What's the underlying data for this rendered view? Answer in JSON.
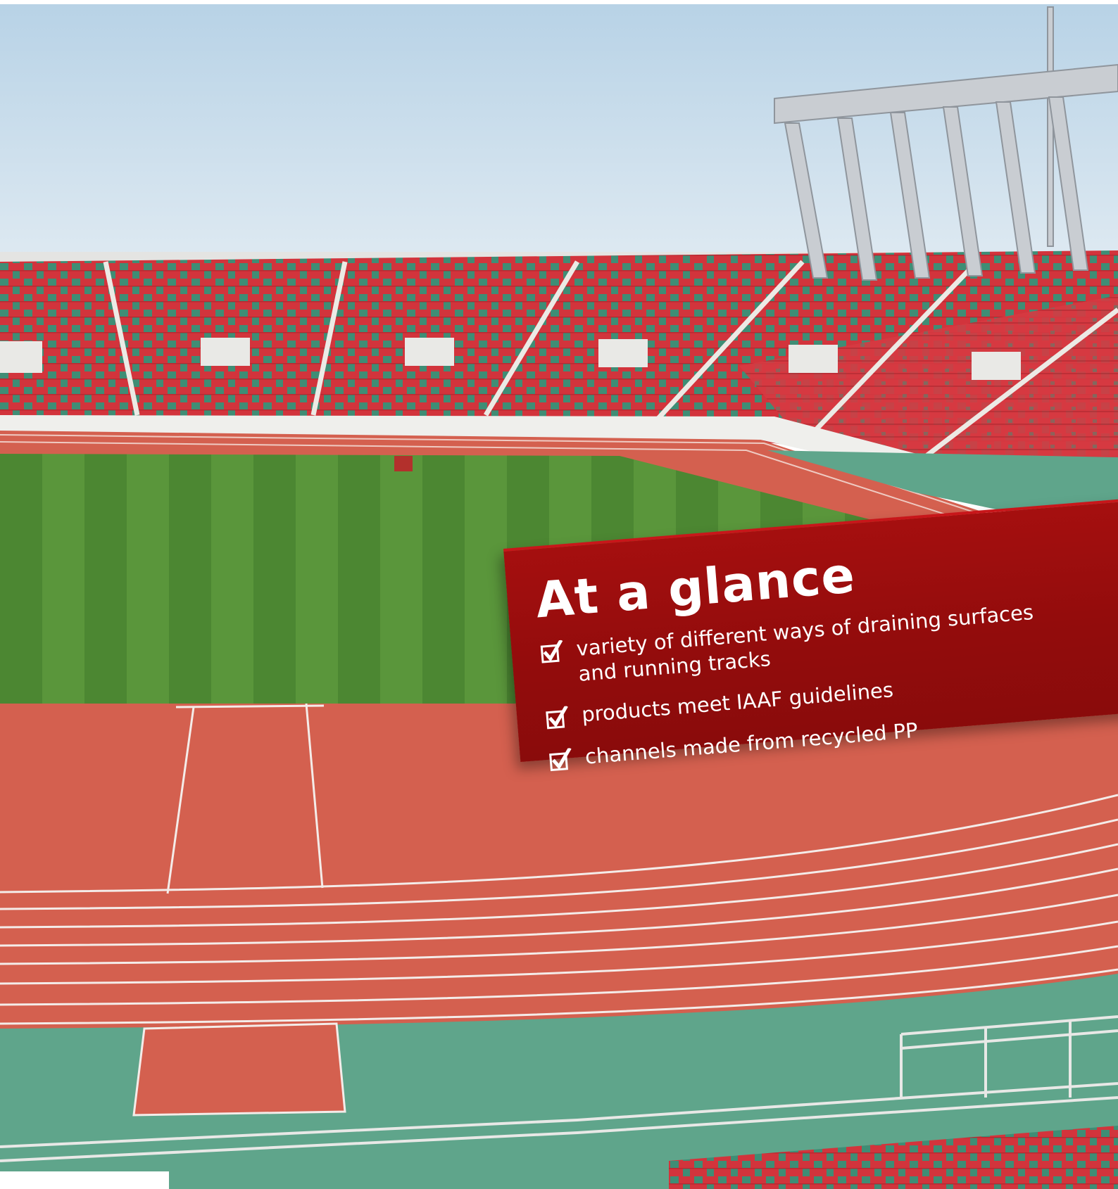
{
  "colors": {
    "sky_top": "#b9d3e6",
    "sky_bottom": "#dbe8f1",
    "seat_red": "#d2343c",
    "seat_green": "#3f8d75",
    "grass_light": "#5f9a3e",
    "grass_dark": "#4d8a32",
    "track": "#d4604f",
    "apron": "#5fa58b",
    "card_red": "#9c0e0e",
    "text": "#ffffff"
  },
  "glance": {
    "title": "At a glance",
    "items": [
      {
        "icon": "checkbox-checked-icon",
        "text": "variety of different ways of draining surfaces\nand running tracks"
      },
      {
        "icon": "checkbox-checked-icon",
        "text": "products meet IAAF guidelines"
      },
      {
        "icon": "checkbox-checked-icon",
        "text": "channels made from recycled PP"
      }
    ]
  }
}
